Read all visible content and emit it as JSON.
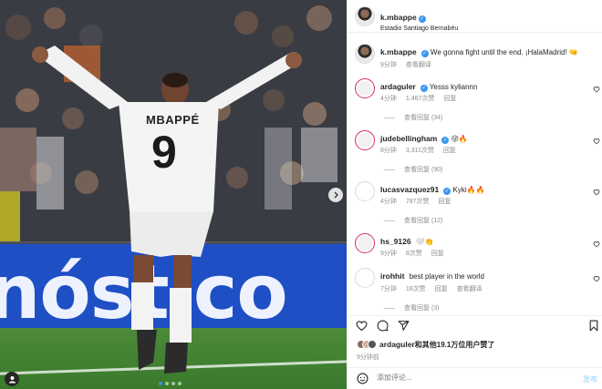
{
  "photo": {
    "jersey_name": "MBAPPÉ",
    "jersey_number": "9",
    "banner_text": "nóstico",
    "carousel_total": 4,
    "carousel_active": 1
  },
  "header": {
    "username": "k.mbappe",
    "location": "Estadio Santiago Bernabéu"
  },
  "caption": {
    "username": "k.mbappe",
    "text": "We gonna fight until the end. ¡HalaMadrid! 🤜",
    "time": "9分钟",
    "translate": "查看翻译"
  },
  "comments": [
    {
      "username": "ardaguler",
      "verified": true,
      "text": "Yesss kyliannn",
      "time": "4分钟",
      "likes": "1,467次赞",
      "reply": "回复",
      "view_replies": "查看回复 (34)",
      "avatar_style": "ring"
    },
    {
      "username": "judebellingham",
      "verified": true,
      "text": "😜🔥",
      "time": "8分钟",
      "likes": "3,311次赞",
      "reply": "回复",
      "view_replies": "查看回复 (90)",
      "avatar_style": "ring"
    },
    {
      "username": "lucasvazquez91",
      "verified": true,
      "text": "Kyki🔥🔥",
      "time": "4分钟",
      "likes": "787次赞",
      "reply": "回复",
      "view_replies": "查看回复 (12)",
      "avatar_style": "plain"
    },
    {
      "username": "hs_9126",
      "verified": false,
      "text": "🤍👏",
      "time": "9分钟",
      "likes": "8次赞",
      "reply": "回复",
      "view_replies": "",
      "avatar_style": "ring"
    },
    {
      "username": "irohhit",
      "verified": false,
      "text": "best player in the world",
      "time": "7分钟",
      "likes": "18次赞",
      "reply": "回复",
      "translate": "查看翻译",
      "view_replies": "查看回复 (3)",
      "avatar_style": "plain"
    }
  ],
  "likes_summary": {
    "username": "ardaguler",
    "text": "和其他19.1万位用户赞了",
    "time": "9分钟前"
  },
  "add_comment": {
    "placeholder": "添加评论...",
    "post_label": "发布"
  },
  "colors": {
    "link_blue": "#3897f0",
    "post_disabled": "#b2dffc",
    "story_ring": "#d62976",
    "banner_blue": "#1f4fc4"
  },
  "icons": [
    "heart-icon",
    "comment-icon",
    "share-icon",
    "bookmark-icon",
    "emoji-icon",
    "verified-icon"
  ]
}
